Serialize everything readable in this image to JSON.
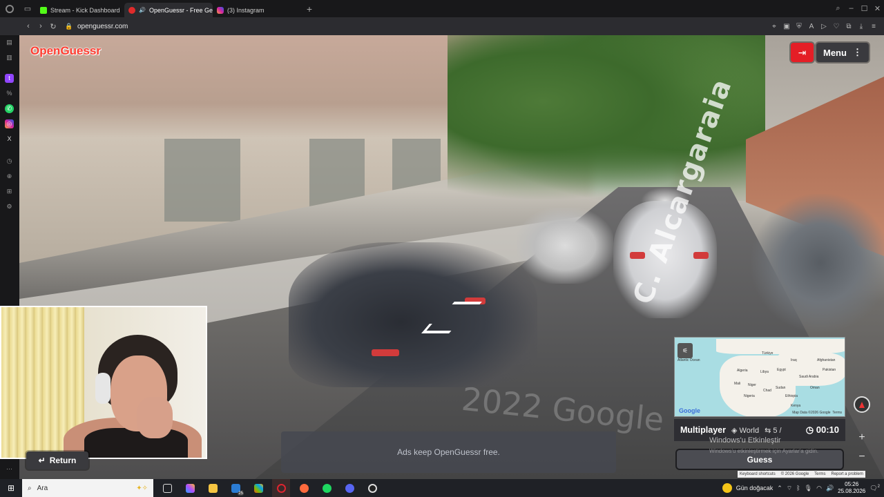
{
  "browser": {
    "tabs": [
      {
        "label": "Stream - Kick Dashboard",
        "favicon": "kick-icon"
      },
      {
        "label": "OpenGuessr - Free Ge",
        "favicon": "openguessr-icon",
        "active": true
      },
      {
        "label": "(3) Instagram",
        "favicon": "instagram-icon"
      }
    ],
    "url": "openguessr.com"
  },
  "game": {
    "logo": "OpenGuessr",
    "menu_label": "Menu",
    "exit_icon": "exit-icon",
    "ads_text": "Ads keep OpenGuessr free.",
    "return_label": "Return",
    "street_label": "C. Alcargaraia",
    "watermark": "2022 Google",
    "map": {
      "labels": [
        "Türkiye",
        "Atlantic Ocean",
        "Iraq",
        "Afghanistan",
        "Algeria",
        "Libya",
        "Egypt",
        "Pakistan",
        "Saudi Arabia",
        "Mali",
        "Niger",
        "Chad",
        "Sudan",
        "Oman",
        "Nigeria",
        "Ethiopia",
        "Kenya"
      ],
      "google": "Google",
      "credit": "Map Data ©2026 Google",
      "terms": "Terms"
    },
    "mode": "Multiplayer",
    "region": "World",
    "rounds": "5 /",
    "timer": "00:10",
    "guess_label": "Guess",
    "windows_activation": "Windows'u Etkinleştir",
    "windows_activation_sub": "Windows'u etkinleştirmek için Ayarlar'a gidin.",
    "footer": [
      "Keyboard shortcuts",
      "© 2026 Google",
      "Terms",
      "Report a problem"
    ]
  },
  "taskbar": {
    "search_placeholder": "Ara",
    "weather": "Gün doğacak",
    "time": "05:26",
    "date": "25.08.2026",
    "badge": "25",
    "notifications": "2"
  }
}
